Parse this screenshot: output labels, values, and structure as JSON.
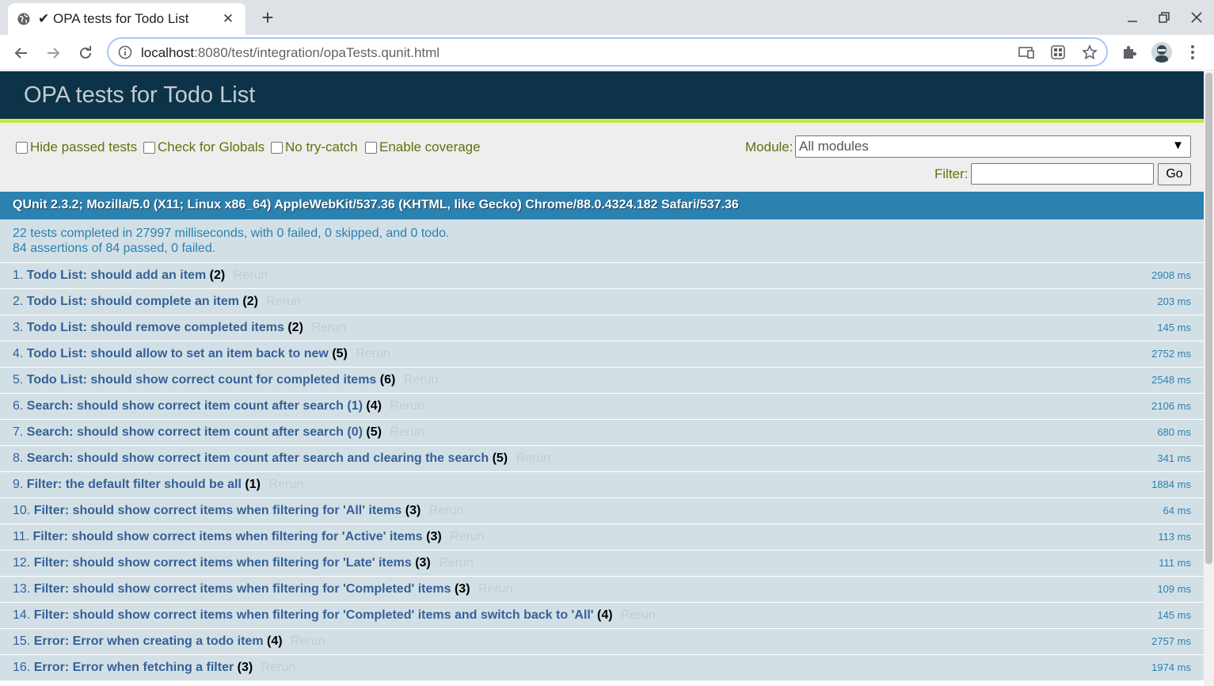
{
  "browser": {
    "tab_title": "✔ OPA tests for Todo List",
    "url_host": "localhost",
    "url_rest": ":8080/test/integration/opaTests.qunit.html"
  },
  "qunit": {
    "title": "OPA tests for Todo List",
    "options": {
      "hide_passed": "Hide passed tests",
      "check_globals": "Check for Globals",
      "no_try_catch": "No try-catch",
      "enable_coverage": "Enable coverage"
    },
    "module_label": "Module:",
    "module_value": "All modules",
    "filter_label": "Filter:",
    "go_label": "Go",
    "user_agent": "QUnit 2.3.2; Mozilla/5.0 (X11; Linux x86_64) AppleWebKit/537.36 (KHTML, like Gecko) Chrome/88.0.4324.182 Safari/537.36",
    "result_line1": "22 tests completed in 27997 milliseconds, with 0 failed, 0 skipped, and 0 todo.",
    "result_line2": "84 assertions of 84 passed, 0 failed.",
    "rerun_label": "Rerun",
    "tests": [
      {
        "num": "1.",
        "module": "Todo List:",
        "name": "should add an item",
        "count": "(2)",
        "runtime": "2908 ms"
      },
      {
        "num": "2.",
        "module": "Todo List:",
        "name": "should complete an item",
        "count": "(2)",
        "runtime": "203 ms"
      },
      {
        "num": "3.",
        "module": "Todo List:",
        "name": "should remove completed items",
        "count": "(2)",
        "runtime": "145 ms"
      },
      {
        "num": "4.",
        "module": "Todo List:",
        "name": "should allow to set an item back to new",
        "count": "(5)",
        "runtime": "2752 ms"
      },
      {
        "num": "5.",
        "module": "Todo List:",
        "name": "should show correct count for completed items",
        "count": "(6)",
        "runtime": "2548 ms"
      },
      {
        "num": "6.",
        "module": "Search:",
        "name": "should show correct item count after search (1)",
        "count": "(4)",
        "runtime": "2106 ms"
      },
      {
        "num": "7.",
        "module": "Search:",
        "name": "should show correct item count after search (0)",
        "count": "(5)",
        "runtime": "680 ms"
      },
      {
        "num": "8.",
        "module": "Search:",
        "name": "should show correct item count after search and clearing the search",
        "count": "(5)",
        "runtime": "341 ms"
      },
      {
        "num": "9.",
        "module": "Filter:",
        "name": "the default filter should be all",
        "count": "(1)",
        "runtime": "1884 ms"
      },
      {
        "num": "10.",
        "module": "Filter:",
        "name": "should show correct items when filtering for 'All' items",
        "count": "(3)",
        "runtime": "64 ms"
      },
      {
        "num": "11.",
        "module": "Filter:",
        "name": "should show correct items when filtering for 'Active' items",
        "count": "(3)",
        "runtime": "113 ms"
      },
      {
        "num": "12.",
        "module": "Filter:",
        "name": "should show correct items when filtering for 'Late' items",
        "count": "(3)",
        "runtime": "111 ms"
      },
      {
        "num": "13.",
        "module": "Filter:",
        "name": "should show correct items when filtering for 'Completed' items",
        "count": "(3)",
        "runtime": "109 ms"
      },
      {
        "num": "14.",
        "module": "Filter:",
        "name": "should show correct items when filtering for 'Completed' items and switch back to 'All'",
        "count": "(4)",
        "runtime": "145 ms"
      },
      {
        "num": "15.",
        "module": "Error:",
        "name": "Error when creating a todo item",
        "count": "(4)",
        "runtime": "2757 ms"
      },
      {
        "num": "16.",
        "module": "Error:",
        "name": "Error when fetching a filter",
        "count": "(3)",
        "runtime": "1974 ms"
      }
    ]
  }
}
